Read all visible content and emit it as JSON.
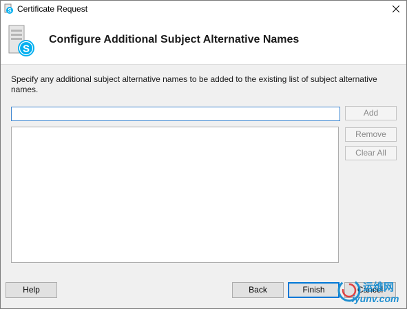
{
  "window": {
    "title": "Certificate Request",
    "close_icon": "close-icon"
  },
  "header": {
    "title": "Configure Additional Subject Alternative Names",
    "icon": "skype-server-icon"
  },
  "main": {
    "description": "Specify any additional subject alternative names to be added to the existing list of subject alternative names.",
    "input_value": "",
    "list_items": [],
    "add_label": "Add",
    "remove_label": "Remove",
    "clear_all_label": "Clear All"
  },
  "footer": {
    "help_label": "Help",
    "back_label": "Back",
    "finish_label": "Finish",
    "cancel_label": "Cancel"
  },
  "watermark": {
    "top_text": "运维网",
    "bottom_text": "iyunv.com"
  },
  "colors": {
    "accent": "#0078d7",
    "input_focus": "#3d86d0",
    "disabled_text": "#8a8a8a",
    "skype_blue": "#00aff0"
  }
}
